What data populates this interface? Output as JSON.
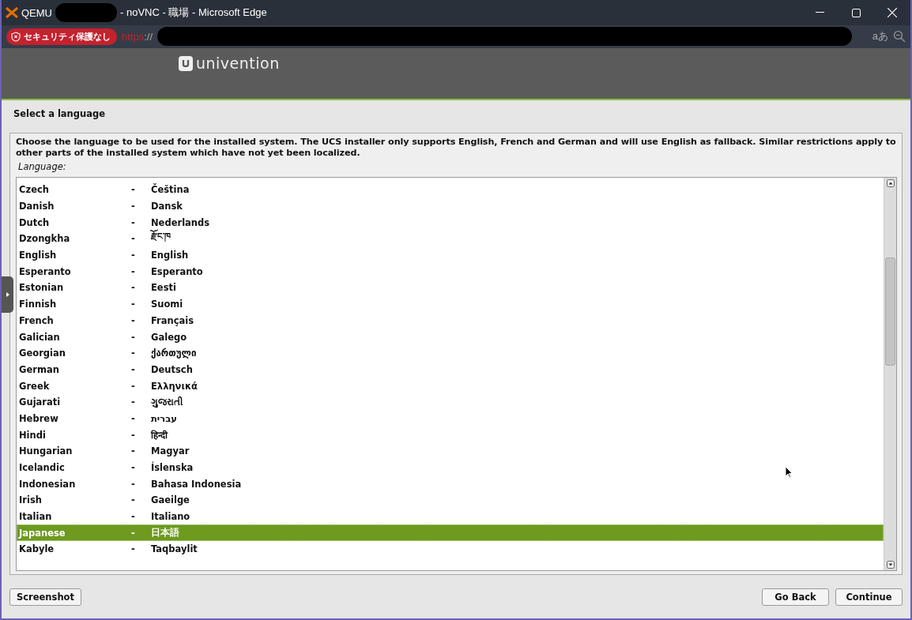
{
  "window": {
    "title_start": "QEMU",
    "title_end": "- noVNC - 職場 - Microsoft Edge"
  },
  "address_bar": {
    "security_badge": "セキュリティ保護なし",
    "url_scheme": "https",
    "url_separator": "://",
    "read_aloud": "aあ"
  },
  "installer": {
    "logo_text": "univention",
    "page_title": "Select a language",
    "description": "Choose the language to be used for the installed system. The UCS installer only supports English, French and German and will use English as fallback. Similar restrictions apply to other parts of the installed system which have not yet been localized.",
    "field_label": "Language:",
    "languages": [
      {
        "name": "Czech",
        "separator": "-",
        "native": "Čeština",
        "selected": false
      },
      {
        "name": "Danish",
        "separator": "-",
        "native": "Dansk",
        "selected": false
      },
      {
        "name": "Dutch",
        "separator": "-",
        "native": "Nederlands",
        "selected": false
      },
      {
        "name": "Dzongkha",
        "separator": "-",
        "native": "རྫོང་ཁ",
        "selected": false
      },
      {
        "name": "English",
        "separator": "-",
        "native": "English",
        "selected": false
      },
      {
        "name": "Esperanto",
        "separator": "-",
        "native": "Esperanto",
        "selected": false
      },
      {
        "name": "Estonian",
        "separator": "-",
        "native": "Eesti",
        "selected": false
      },
      {
        "name": "Finnish",
        "separator": "-",
        "native": "Suomi",
        "selected": false
      },
      {
        "name": "French",
        "separator": "-",
        "native": "Français",
        "selected": false
      },
      {
        "name": "Galician",
        "separator": "-",
        "native": "Galego",
        "selected": false
      },
      {
        "name": "Georgian",
        "separator": "-",
        "native": "ქართული",
        "selected": false
      },
      {
        "name": "German",
        "separator": "-",
        "native": "Deutsch",
        "selected": false
      },
      {
        "name": "Greek",
        "separator": "-",
        "native": "Ελληνικά",
        "selected": false
      },
      {
        "name": "Gujarati",
        "separator": "-",
        "native": "ગુજરાતી",
        "selected": false
      },
      {
        "name": "Hebrew",
        "separator": "-",
        "native": "עברית",
        "selected": false
      },
      {
        "name": "Hindi",
        "separator": "-",
        "native": "हिन्दी",
        "selected": false
      },
      {
        "name": "Hungarian",
        "separator": "-",
        "native": "Magyar",
        "selected": false
      },
      {
        "name": "Icelandic",
        "separator": "-",
        "native": "Íslenska",
        "selected": false
      },
      {
        "name": "Indonesian",
        "separator": "-",
        "native": "Bahasa Indonesia",
        "selected": false
      },
      {
        "name": "Irish",
        "separator": "-",
        "native": "Gaeilge",
        "selected": false
      },
      {
        "name": "Italian",
        "separator": "-",
        "native": "Italiano",
        "selected": false
      },
      {
        "name": "Japanese",
        "separator": "-",
        "native": "日本語",
        "selected": true
      },
      {
        "name": "Kabyle",
        "separator": "-",
        "native": "Taqbaylit",
        "selected": false
      }
    ],
    "buttons": {
      "left": [
        "Screenshot"
      ],
      "right": [
        "Go Back",
        "Continue"
      ]
    }
  }
}
